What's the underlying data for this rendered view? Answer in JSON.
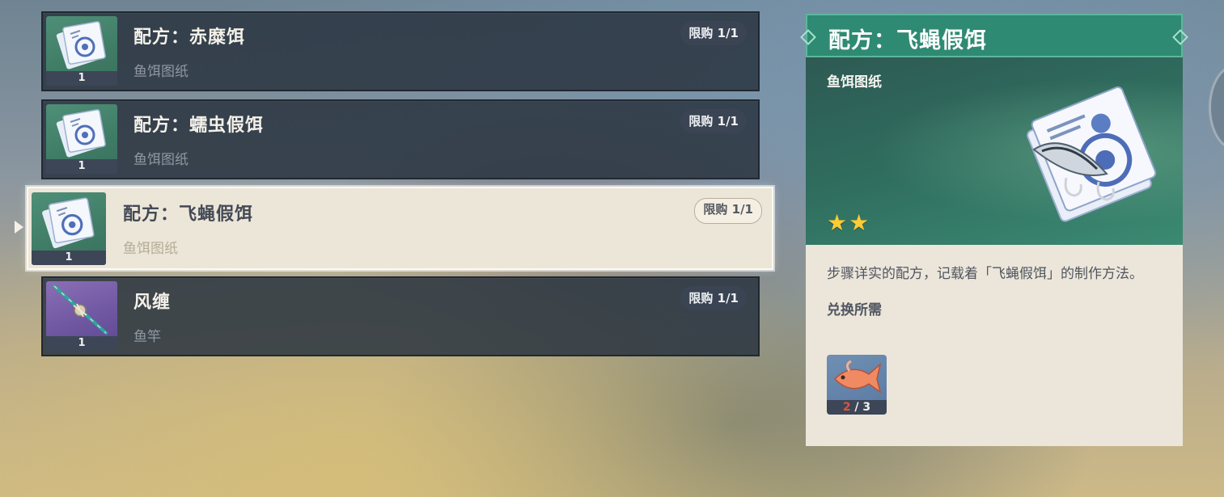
{
  "items": [
    {
      "title": "配方：赤糜饵",
      "category": "鱼饵图纸",
      "limit": "限购 1/1",
      "count": "1",
      "icon": "bait-blueprint-icon",
      "selected": false
    },
    {
      "title": "配方：蠕虫假饵",
      "category": "鱼饵图纸",
      "limit": "限购 1/1",
      "count": "1",
      "icon": "bait-blueprint-icon",
      "selected": false
    },
    {
      "title": "配方：飞蝇假饵",
      "category": "鱼饵图纸",
      "limit": "限购 1/1",
      "count": "1",
      "icon": "bait-blueprint-icon",
      "selected": true
    },
    {
      "title": "风缠",
      "category": "鱼竿",
      "limit": "限购 1/1",
      "count": "1",
      "icon": "fishing-rod-icon",
      "selected": false
    }
  ],
  "detail": {
    "title": "配方：飞蝇假饵",
    "type": "鱼饵图纸",
    "rarity": 2,
    "star_glyph": "★",
    "description": "步骤详实的配方，记载着「飞蝇假饵」的制作方法。",
    "requirement_label": "兑换所需",
    "requirement": {
      "icon": "fish-icon",
      "have": "2",
      "need": " / 3"
    }
  },
  "colors": {
    "header_green": "#2f8a73",
    "panel_cream": "#ece6da",
    "star_gold": "#ffcc33",
    "row_dark": "#2a3440",
    "shortfall_red": "#e0533c"
  }
}
